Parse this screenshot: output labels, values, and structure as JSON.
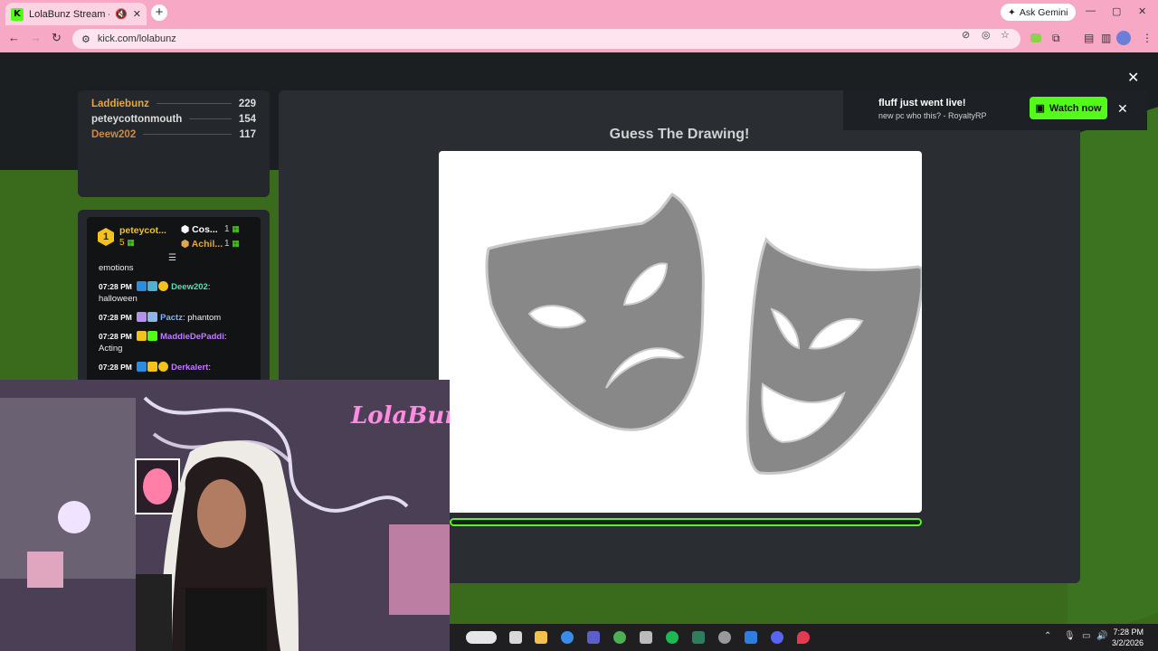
{
  "browser": {
    "tab_title": "LolaBunz Stream - Watch Li...",
    "tab_favicon": "K",
    "new_tab": "+",
    "ask_gemini": "Ask Gemini",
    "url": "kick.com/lolabunz"
  },
  "leaderboard": {
    "rows": [
      {
        "name": "Laddiebunz",
        "score": "229",
        "color": "#e8a63c"
      },
      {
        "name": "peteycottonmouth",
        "score": "154",
        "color": "#dddddd"
      },
      {
        "name": "Deew202",
        "score": "117",
        "color": "#c98a4a"
      }
    ]
  },
  "chat": {
    "top_user": "peteycot...",
    "top_user_count": "5",
    "top_badge": "1",
    "second_user": "Cos...",
    "second_count": "1",
    "third_user": "Achil...",
    "third_count": "1",
    "first_line": "emotions",
    "messages": [
      {
        "time": "07:28 PM",
        "user": "Deew202",
        "text": "halloween",
        "color": "#53e0b6"
      },
      {
        "time": "07:28 PM",
        "user": "Pactz",
        "text": "phantom",
        "color": "#7fb2ff"
      },
      {
        "time": "07:28 PM",
        "user": "MaddieDePaddi",
        "text": "Acting",
        "color": "#c07cff"
      },
      {
        "time": "07:28 PM",
        "user": "Derkalert",
        "text": "",
        "color": "#c07cff"
      }
    ]
  },
  "game": {
    "title": "Guess The Drawing!",
    "timer_fraction": 1.0
  },
  "notification": {
    "title": "fluff just went live!",
    "subtitle": "new pc who this? - RoyaltyRP",
    "button": "Watch now"
  },
  "webcam": {
    "neon_sign": "LolaBunz"
  },
  "taskbar": {
    "time": "7:28 PM",
    "date": "3/2/2026"
  },
  "colors": {
    "kick_green": "#53fc18",
    "browser_pink": "#f7a8c4"
  }
}
